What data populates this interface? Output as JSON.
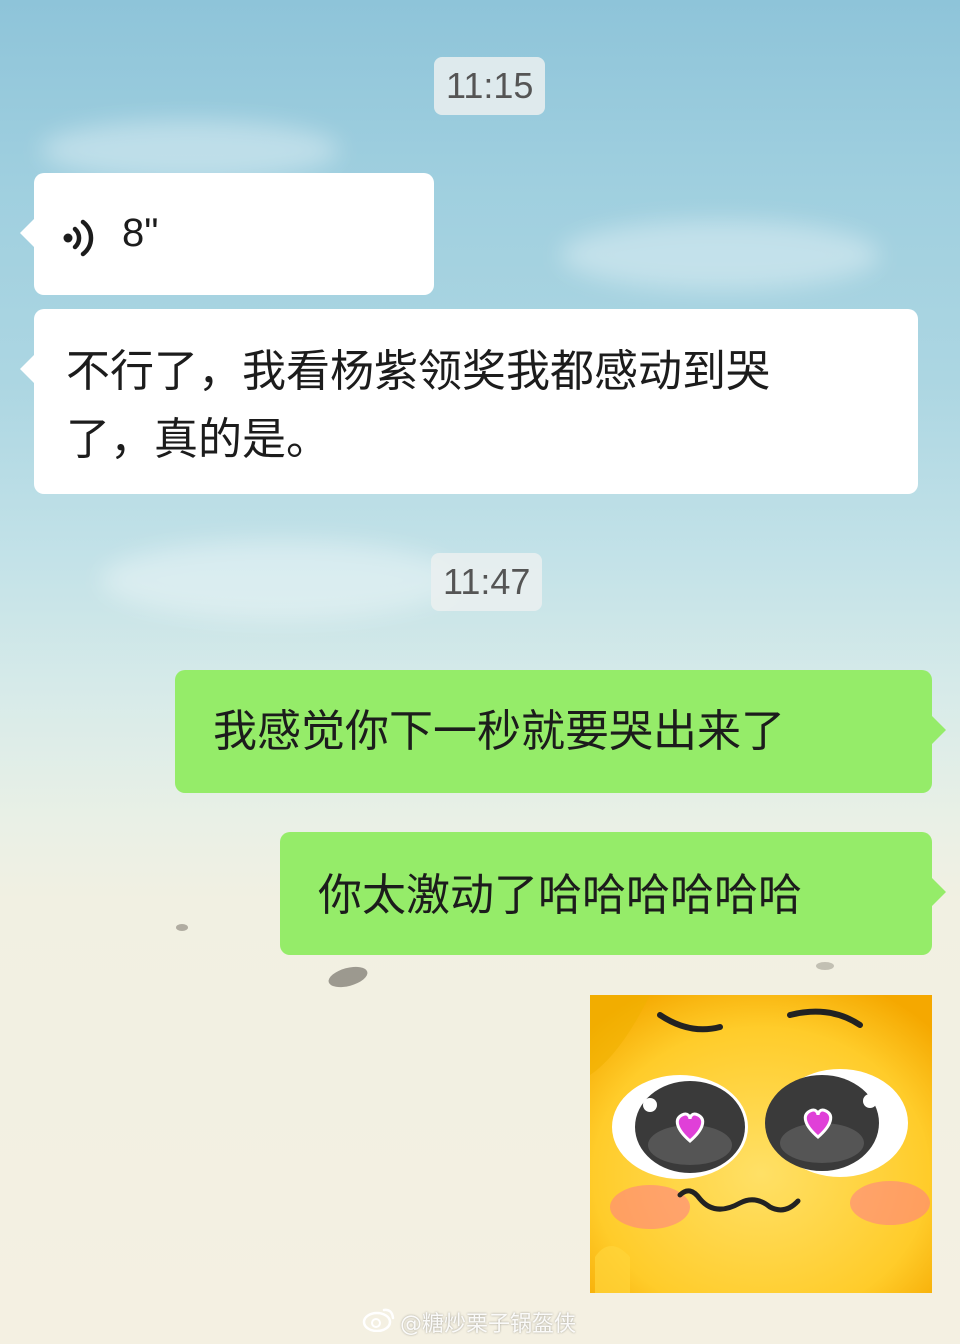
{
  "messages": [
    {
      "type": "timestamp",
      "text": "11:15"
    },
    {
      "type": "voice",
      "direction": "incoming",
      "duration": "8\""
    },
    {
      "type": "text",
      "direction": "incoming",
      "line1": "不行了，我看杨紫领奖我都感动到哭",
      "line2": "了，真的是。"
    },
    {
      "type": "timestamp",
      "text": "11:47"
    },
    {
      "type": "text",
      "direction": "outgoing",
      "text": "我感觉你下一秒就要哭出来了"
    },
    {
      "type": "text",
      "direction": "outgoing",
      "text": "你太激动了哈哈哈哈哈哈"
    },
    {
      "type": "sticker",
      "direction": "outgoing",
      "sticker": "heart-eyes-emoji-sticker"
    }
  ],
  "watermark": {
    "text": "@糖炒栗子锅盔侠",
    "icon": "weibo-icon"
  },
  "colors": {
    "outgoing_bubble": "#95ec69",
    "incoming_bubble": "#ffffff"
  }
}
